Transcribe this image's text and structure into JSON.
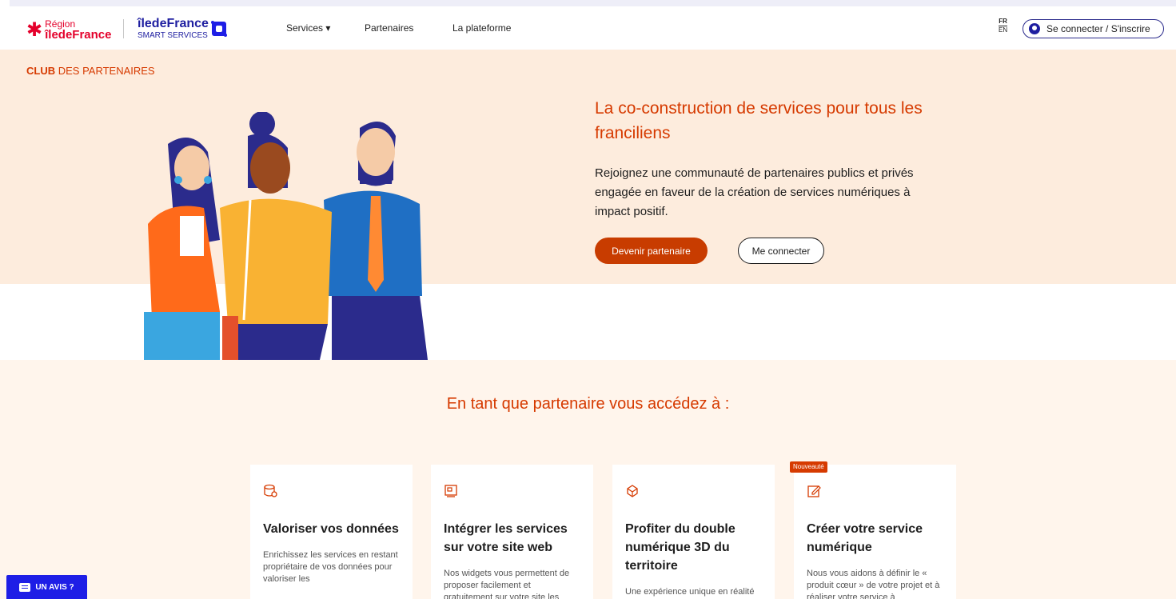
{
  "header": {
    "region_logo_line1": "Région",
    "region_logo_line2": "îledeFrance",
    "idf_logo_bold": "îledeFrance",
    "idf_logo_sub": "SMART SERVICES",
    "nav": [
      {
        "label": "Services ▾"
      },
      {
        "label": "Partenaires"
      },
      {
        "label": "La plateforme"
      }
    ],
    "lang_active": "FR",
    "lang_other": "EN",
    "login_label": "Se connecter / S'inscrire"
  },
  "hero": {
    "club_bold": "CLUB",
    "club_rest": " DES PARTENAIRES",
    "title": "La co-construction de services pour tous les franciliens",
    "text": "Rejoignez une communauté de partenaires publics et privés engagée en faveur de la création de services numériques à impact positif.",
    "primary_button": "Devenir partenaire",
    "secondary_button": "Me connecter"
  },
  "benefits": {
    "title": "En tant que partenaire vous accédez à :",
    "badge": "Nouveauté",
    "cards": [
      {
        "icon": "data-icon",
        "title": "Valoriser vos données",
        "text": "Enrichissez les services en restant propriétaire de vos données pour valoriser les"
      },
      {
        "icon": "widget-icon",
        "title": "Intégrer les services sur votre site web",
        "text": "Nos widgets vous permettent de proposer facilement et gratuitement sur votre site les"
      },
      {
        "icon": "cube-3d-icon",
        "title": "Profiter du double numérique 3D du territoire",
        "text": "Une expérience unique en réalité augmentée et virtuelle"
      },
      {
        "icon": "edit-icon",
        "title": "Créer votre service numérique",
        "text": "Nous vous aidons à définir le « produit cœur » de votre projet et à réaliser votre service à"
      }
    ]
  },
  "feedback_button": "UN AVIS ?",
  "colors": {
    "accent": "#d63a00",
    "brand_blue": "#1e1ea0",
    "hero_bg": "#fdecdd"
  }
}
